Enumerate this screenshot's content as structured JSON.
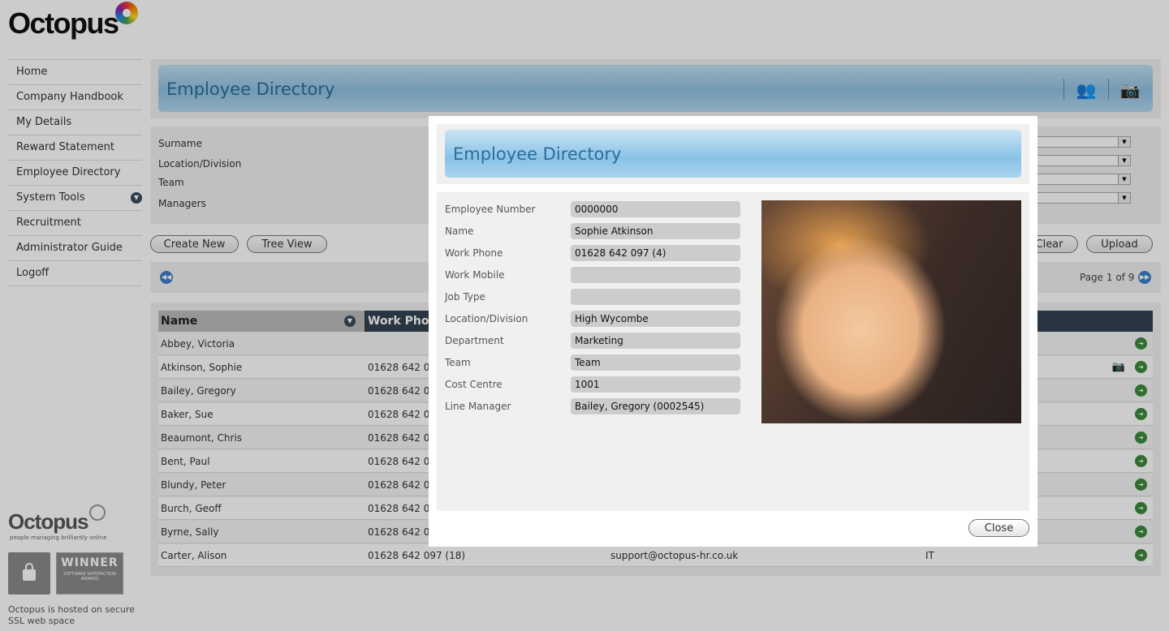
{
  "app": {
    "logo_text": "Octopus",
    "footer_logo_text": "Octopus",
    "footer_tagline": "people managing brilliantly online",
    "badge_winner": "WINNER",
    "badge_sub": "SOFTWARE SATISFACTION AWARDS",
    "ssl_note": "Octopus is hosted on secure SSL web space"
  },
  "sidebar": {
    "items": [
      {
        "label": "Home"
      },
      {
        "label": "Company Handbook"
      },
      {
        "label": "My Details"
      },
      {
        "label": "Reward Statement"
      },
      {
        "label": "Employee Directory"
      },
      {
        "label": "System Tools"
      },
      {
        "label": "Recruitment"
      },
      {
        "label": "Administrator Guide"
      },
      {
        "label": "Logoff"
      }
    ]
  },
  "header": {
    "title": "Employee Directory",
    "icons": [
      "people-icon",
      "camera-icon"
    ]
  },
  "filters": {
    "labels": [
      "Surname",
      "Location/Division",
      "Team",
      "Managers"
    ]
  },
  "toolbar": {
    "create_new": "Create New",
    "tree_view": "Tree View",
    "clear": "Clear",
    "upload": "Upload"
  },
  "pager": {
    "info": "Page 1 of 9"
  },
  "table": {
    "columns": [
      "Name",
      "Work Phon"
    ],
    "rows": [
      {
        "name": "Abbey, Victoria",
        "phone": "",
        "email": "",
        "team": ""
      },
      {
        "name": "Atkinson, Sophie",
        "phone": "01628 642 09",
        "email": "",
        "team": ""
      },
      {
        "name": "Bailey, Gregory",
        "phone": "01628 642 09",
        "email": "",
        "team": ""
      },
      {
        "name": "Baker, Sue",
        "phone": "01628 642 09",
        "email": "",
        "team": ""
      },
      {
        "name": "Beaumont, Chris",
        "phone": "01628 642 09",
        "email": "",
        "team": ""
      },
      {
        "name": "Bent, Paul",
        "phone": "01628 642 09",
        "email": "",
        "team": ""
      },
      {
        "name": "Blundy, Peter",
        "phone": "01628 642 09",
        "email": "",
        "team": ""
      },
      {
        "name": "Burch, Geoff",
        "phone": "01628 642 09",
        "email": "",
        "team": ""
      },
      {
        "name": "Byrne, Sally",
        "phone": "01628 642 09",
        "email": "",
        "team": ""
      },
      {
        "name": "Carter, Alison",
        "phone": "01628 642 097 (18)",
        "email": "support@octopus-hr.co.uk",
        "team": "IT"
      }
    ]
  },
  "modal": {
    "title": "Employee Directory",
    "fields": [
      {
        "label": "Employee Number",
        "value": "0000000"
      },
      {
        "label": "Name",
        "value": "Sophie Atkinson"
      },
      {
        "label": "Work Phone",
        "value": "01628 642 097 (4)"
      },
      {
        "label": "Work Mobile",
        "value": ""
      },
      {
        "label": "Job Type",
        "value": ""
      },
      {
        "label": "Location/Division",
        "value": "High Wycombe"
      },
      {
        "label": "Department",
        "value": "Marketing"
      },
      {
        "label": "Team",
        "value": "Team"
      },
      {
        "label": "Cost Centre",
        "value": "1001"
      },
      {
        "label": "Line Manager",
        "value": "Bailey, Gregory (0002545)"
      }
    ],
    "close_label": "Close"
  }
}
